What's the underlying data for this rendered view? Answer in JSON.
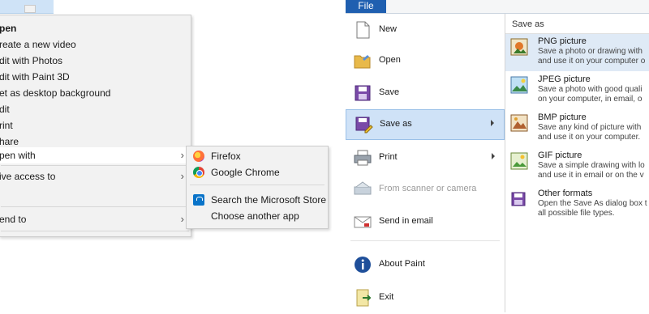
{
  "context_menu": {
    "items": [
      {
        "label": "pen",
        "bold": true
      },
      {
        "label": "reate a new video"
      },
      {
        "label": "dit with Photos"
      },
      {
        "label": "dit with Paint 3D"
      },
      {
        "label": "et as desktop background"
      },
      {
        "label": "dit"
      },
      {
        "label": "rint"
      },
      {
        "label": "hare"
      },
      {
        "label": "pen with"
      },
      {
        "label": "ive access to"
      },
      {
        "label": "end to"
      }
    ],
    "open_with": {
      "apps": [
        {
          "label": "Firefox",
          "icon": "firefox-icon"
        },
        {
          "label": "Google Chrome",
          "icon": "chrome-icon"
        }
      ],
      "store": {
        "label": "Search the Microsoft Store",
        "icon": "microsoft-store-icon"
      },
      "choose": {
        "label": "Choose another app"
      }
    }
  },
  "paint": {
    "file_tab": "File",
    "commands": [
      {
        "label": "New",
        "icon": "new-file-icon"
      },
      {
        "label": "Open",
        "icon": "open-folder-icon"
      },
      {
        "label": "Save",
        "icon": "save-disk-icon"
      },
      {
        "label": "Save as",
        "icon": "save-as-icon"
      },
      {
        "label": "Print",
        "icon": "printer-icon"
      },
      {
        "label": "From scanner or camera",
        "icon": "scanner-icon"
      },
      {
        "label": "Send in email",
        "icon": "email-icon"
      },
      {
        "label": "About Paint",
        "icon": "info-icon"
      },
      {
        "label": "Exit",
        "icon": "exit-icon"
      }
    ],
    "save_as": {
      "heading": "Save as",
      "formats": [
        {
          "title": "PNG picture",
          "desc": "Save a photo or drawing with\nand use it on your computer o",
          "icon": "png-picture-icon"
        },
        {
          "title": "JPEG picture",
          "desc": "Save a photo with good quali\non your computer, in email, o",
          "icon": "jpeg-picture-icon"
        },
        {
          "title": "BMP picture",
          "desc": "Save any kind of picture with\nand use it on your computer.",
          "icon": "bmp-picture-icon"
        },
        {
          "title": "GIF picture",
          "desc": "Save a simple drawing with lo\nand use it in email or on the v",
          "icon": "gif-picture-icon"
        },
        {
          "title": "Other formats",
          "desc": "Open the Save As dialog box t\nall possible file types.",
          "icon": "other-formats-icon"
        }
      ]
    },
    "colors": {
      "file_tab": "#1f5fb0",
      "highlight": "#cfe2f7"
    }
  }
}
